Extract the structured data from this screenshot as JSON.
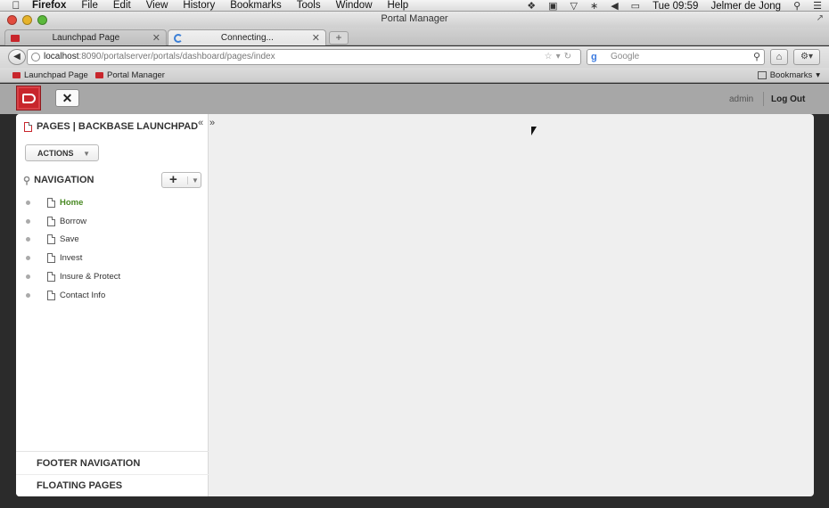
{
  "menubar": {
    "app": "Firefox",
    "items": [
      "File",
      "Edit",
      "View",
      "History",
      "Bookmarks",
      "Tools",
      "Window",
      "Help"
    ],
    "clock": "Tue 09:59",
    "user": "Jelmer de Jong"
  },
  "window": {
    "title": "Portal Manager"
  },
  "tabs": [
    {
      "label": "Launchpad Page"
    },
    {
      "label": "Connecting..."
    }
  ],
  "url": {
    "host": "localhost",
    "path": ":8090/portalserver/portals/dashboard/pages/index"
  },
  "search": {
    "placeholder": "Google"
  },
  "bookmarks": {
    "items": [
      {
        "label": "Launchpad Page"
      },
      {
        "label": "Portal Manager"
      }
    ],
    "menu_label": "Bookmarks"
  },
  "portal_header": {
    "user": "admin",
    "logout": "Log Out"
  },
  "sidebar": {
    "title": "PAGES | BACKBASE LAUNCHPAD",
    "actions_label": "ACTIONS",
    "navigation_label": "NAVIGATION",
    "nav_items": [
      {
        "label": "Home",
        "active": true
      },
      {
        "label": "Borrow"
      },
      {
        "label": "Save"
      },
      {
        "label": "Invest"
      },
      {
        "label": "Insure & Protect"
      },
      {
        "label": "Contact Info"
      }
    ],
    "footer": {
      "footer_nav": "FOOTER NAVIGATION",
      "floating": "FLOATING PAGES"
    }
  },
  "colors": {
    "brand": "#c8262c",
    "active_nav": "#4a8a24"
  }
}
